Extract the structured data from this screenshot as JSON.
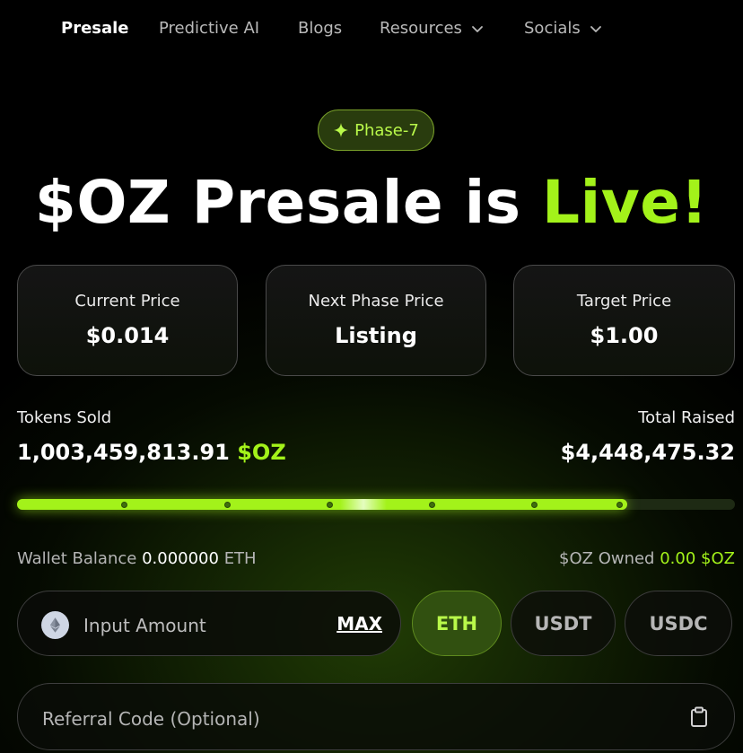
{
  "nav": {
    "items": [
      {
        "label": "Presale",
        "active": true
      },
      {
        "label": "Predictive AI"
      },
      {
        "label": "Blogs"
      },
      {
        "label": "Resources",
        "dropdown": true
      },
      {
        "label": "Socials",
        "dropdown": true
      }
    ]
  },
  "badge": {
    "label": "Phase-7",
    "icon": "sparkle-icon"
  },
  "headline": {
    "main": "$OZ Presale is ",
    "accent": "Live!"
  },
  "prices": [
    {
      "label": "Current Price",
      "value": "$0.014"
    },
    {
      "label": "Next Phase Price",
      "value": "Listing"
    },
    {
      "label": "Target Price",
      "value": "$1.00"
    }
  ],
  "stats": {
    "tokens_sold_label": "Tokens Sold",
    "tokens_sold_value": "1,003,459,813.91",
    "tokens_sold_unit": "$OZ",
    "total_raised_label": "Total Raised",
    "total_raised_value": "$4,448,475.32"
  },
  "progress": {
    "fraction": 0.85
  },
  "wallet": {
    "balance_label": "Wallet Balance",
    "balance_value": "0.000000",
    "balance_unit": "ETH",
    "owned_label": "$OZ Owned",
    "owned_value": "0.00 $OZ"
  },
  "purchase": {
    "amount_placeholder": "Input Amount",
    "max_label": "MAX",
    "currencies": [
      {
        "label": "ETH",
        "selected": true
      },
      {
        "label": "USDT"
      },
      {
        "label": "USDC"
      }
    ],
    "referral_placeholder": "Referral Code (Optional)"
  },
  "colors": {
    "accent": "#a3f21a",
    "background": "#000000"
  }
}
